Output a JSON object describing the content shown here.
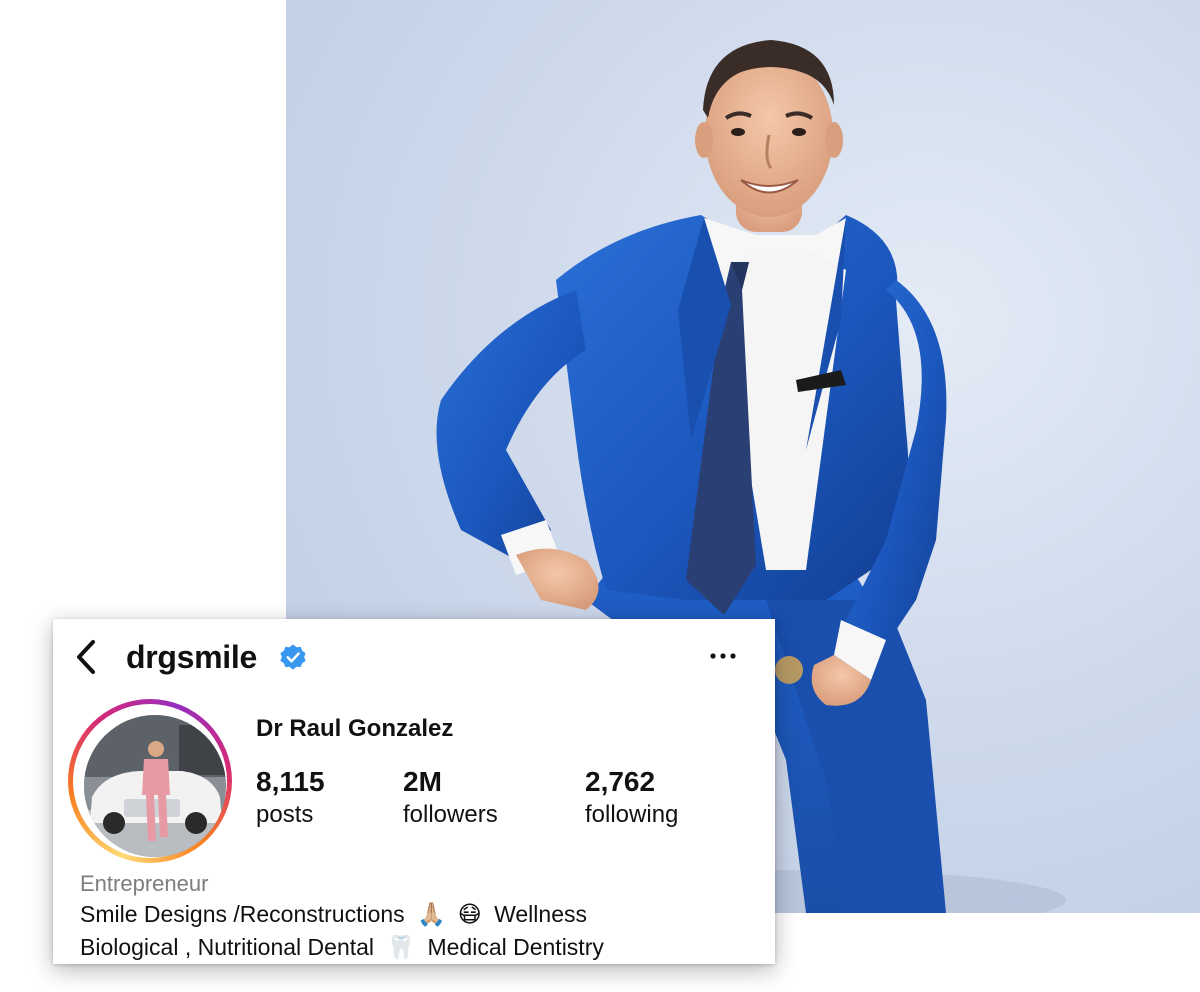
{
  "profile": {
    "username": "drgsmile",
    "display_name": "Dr Raul Gonzalez",
    "verified": true,
    "stats": [
      {
        "value": "8,115",
        "label": "posts"
      },
      {
        "value": "2M",
        "label": "followers"
      },
      {
        "value": "2,762",
        "label": "following"
      }
    ],
    "category": "Entrepreneur",
    "bio_line_1": {
      "text": "Smile Designs /Reconstructions",
      "emoji_1": "🙏🏼",
      "emoji_2": "😷",
      "text_after": "Wellness"
    },
    "bio_line_2": {
      "text": "Biological , Nutritional Dental",
      "emoji_1": "🦷",
      "text_after": "Medical Dentistry"
    }
  },
  "icons": {
    "back": "chevron-left-icon",
    "verified": "verified-badge-icon",
    "more": "more-horizontal-icon"
  },
  "colors": {
    "verified_blue": "#3897f0",
    "suit_blue": "#1d5bc2",
    "text_primary": "#111111",
    "text_secondary": "#7d7d7d"
  }
}
